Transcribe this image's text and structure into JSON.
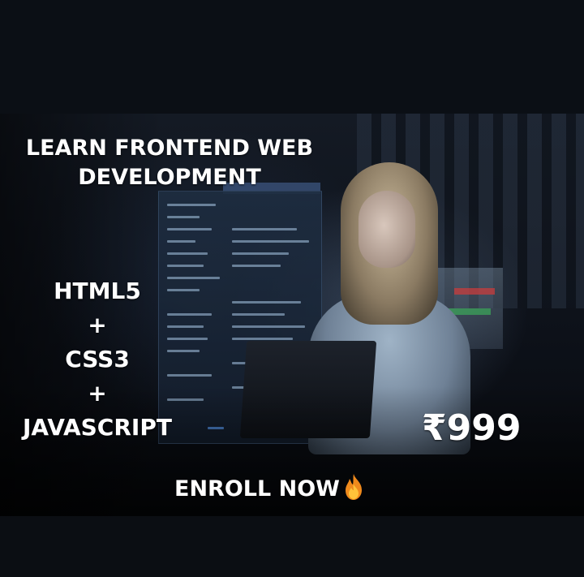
{
  "headline": {
    "line1": "LEARN FRONTEND WEB",
    "line2": "DEVELOPMENT"
  },
  "tech_stack": [
    "HTML5",
    "+",
    "CSS3",
    "+",
    "JAVASCRIPT"
  ],
  "price": "₹999",
  "cta": {
    "label": "ENROLL NOW",
    "icon": "fire-icon"
  },
  "colors": {
    "text": "#ffffff",
    "background": "#0b0e13"
  }
}
